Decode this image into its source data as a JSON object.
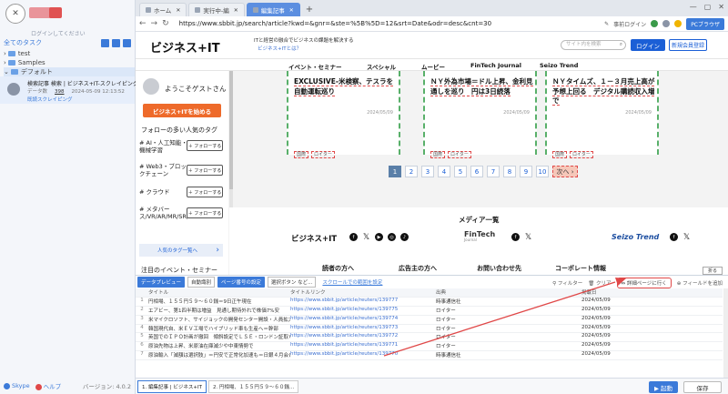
{
  "sidebar": {
    "login_hint": "ログインしてください",
    "all_tasks": "全てのタスク",
    "tree": [
      {
        "label": "test"
      },
      {
        "label": "Samples"
      },
      {
        "label": "デフォルト"
      }
    ],
    "task": {
      "title": "検索記事 検索 | ビジネス+IT-スクレイピング",
      "meta_label": "データ数",
      "meta_count": "398",
      "meta_time": "2024-05-09 12:13:52",
      "status": "既読スクレイピング"
    },
    "footer": {
      "skype": "Skype",
      "help": "ヘルプ",
      "version": "バージョン: 4.0.2"
    }
  },
  "browser": {
    "tabs": [
      {
        "label": "ホーム"
      },
      {
        "label": "実行中-編"
      },
      {
        "label": "編集記事"
      }
    ],
    "url": "https://www.sbbit.jp/search/article?kwd=&gnr=&ste=%5B%5D=12&srt=Date&odr=desc&cnt=30",
    "addr_label": "事前ログイン",
    "pc_browser": "PCブラウザ"
  },
  "site": {
    "brand": "ビジネス+IT",
    "tagline": "ITと経営の融合でビジネスの課題を解決する",
    "tagline_link": "ビジネス+ITとは？",
    "search_placeholder": "サイト内を検索",
    "login": "ログイン",
    "signup": "新規会員登録",
    "nav": [
      {
        "label": "イベント・セミナー"
      },
      {
        "label": "スペシャル"
      },
      {
        "label": "ムービー"
      },
      {
        "label": "FinTech Journal"
      },
      {
        "label": "Seizo Trend"
      }
    ],
    "welcome": "ようこそゲストさん",
    "start_button": "ビジネス+ITを始める",
    "tags_title": "フォローの多い人気のタグ",
    "tags": [
      {
        "label": "# AI・人工知能・機械学習"
      },
      {
        "label": "# Web3・ブロックチェーン"
      },
      {
        "label": "# クラウド"
      },
      {
        "label": "# メタバース/VR/AR/MR/SR/xR"
      }
    ],
    "follow_label": "＋ フォローする",
    "more_tags": "人気のタグ一覧へ",
    "events_title": "注目のイベント・セミナー",
    "articles": [
      {
        "title": "EXCLUSIVE-米検察、テスラを自動運転巡り",
        "date": "2024/05/09",
        "tag1": "国際",
        "tag2": "ロイター"
      },
      {
        "title": "ＮＹ外為市場＝ドル上昇、金利見通しを巡り　円は3日続落",
        "date": "2024/05/09",
        "tag1": "国際",
        "tag2": "ロイター"
      },
      {
        "title": "ＮＹタイムズ、１－３月売上高が予想上回る　デジタル購読収入増で",
        "date": "2024/05/09",
        "tag1": "国際",
        "tag2": "ロイター"
      }
    ],
    "pages": [
      "1",
      "2",
      "3",
      "4",
      "5",
      "6",
      "7",
      "8",
      "9",
      "10"
    ],
    "next_label": "次へ",
    "media_title": "メディア一覧",
    "footer_brands": [
      "ビジネス+IT",
      "FinTech",
      "Seizo Trend"
    ],
    "footer_brand_sub": "Journal",
    "footer_links": [
      "読者の方へ",
      "広告主の方へ",
      "お問い合わせ先",
      "コーポレート情報"
    ]
  },
  "panel": {
    "collapse": "折る",
    "data_preview": "データプレビュー",
    "auto_detect": "自動識別",
    "page_setting": "ページ番号の設定",
    "select_button": "選択ボタン など...",
    "scroll_setting": "スクロールでの範囲を設定",
    "filter": "フィルター",
    "clear": "クリア",
    "goto_detail": "詳細ページに行く",
    "add_field": "フィールドを追加",
    "headers": [
      "タイトル",
      "タイトルリンク",
      "出典",
      "掲載日"
    ],
    "rows": [
      [
        "円相場、１５５円５９～６０銭＝9日正午現在",
        "https://www.sbbit.jp/article/reuters/139777",
        "時事通信社",
        "2024/05/09"
      ],
      [
        "エアビー、第1四半期は増益　見通し期待外れで株価7%安",
        "https://www.sbbit.jp/article/reuters/139775",
        "ロイター",
        "2024/05/09"
      ],
      [
        "米マイクロソフト、サイジョックの開発センター開設・人員拡大へ",
        "https://www.sbbit.jp/article/reuters/139774",
        "ロイター",
        "2024/05/09"
      ],
      [
        "韓国現代自、米ＥＶ工場でハイブリッド車も生産へ＝幹部",
        "https://www.sbbit.jp/article/reuters/139773",
        "ロイター",
        "2024/05/09"
      ],
      [
        "英国でのＩＰＯ計画が撤回　傾斜設定でＬＳＥ・ロンドン証取ＣＥＯ",
        "https://www.sbbit.jp/article/reuters/139772",
        "ロイター",
        "2024/05/09"
      ],
      [
        "原油先物は上昇、米原油在庫減少や中東情勢で",
        "https://www.sbbit.jp/article/reuters/139771",
        "ロイター",
        "2024/05/09"
      ],
      [
        "原油輸入「減額は選択肢」＝円安で正常化加速も＝日銀４月会合",
        "https://www.sbbit.jp/article/reuters/139770",
        "時事通信社",
        "2024/05/09"
      ]
    ],
    "bottom_tabs": [
      "1. 編集記事 | ビジネス+IT",
      "2. 円相場、１５５円５９～６０銭…"
    ],
    "run": "▶ 起動",
    "save": "保存"
  },
  "colors": {
    "accent": "#3b7ad9",
    "highlight": "#e04848",
    "orange": "#ee6a2a"
  }
}
